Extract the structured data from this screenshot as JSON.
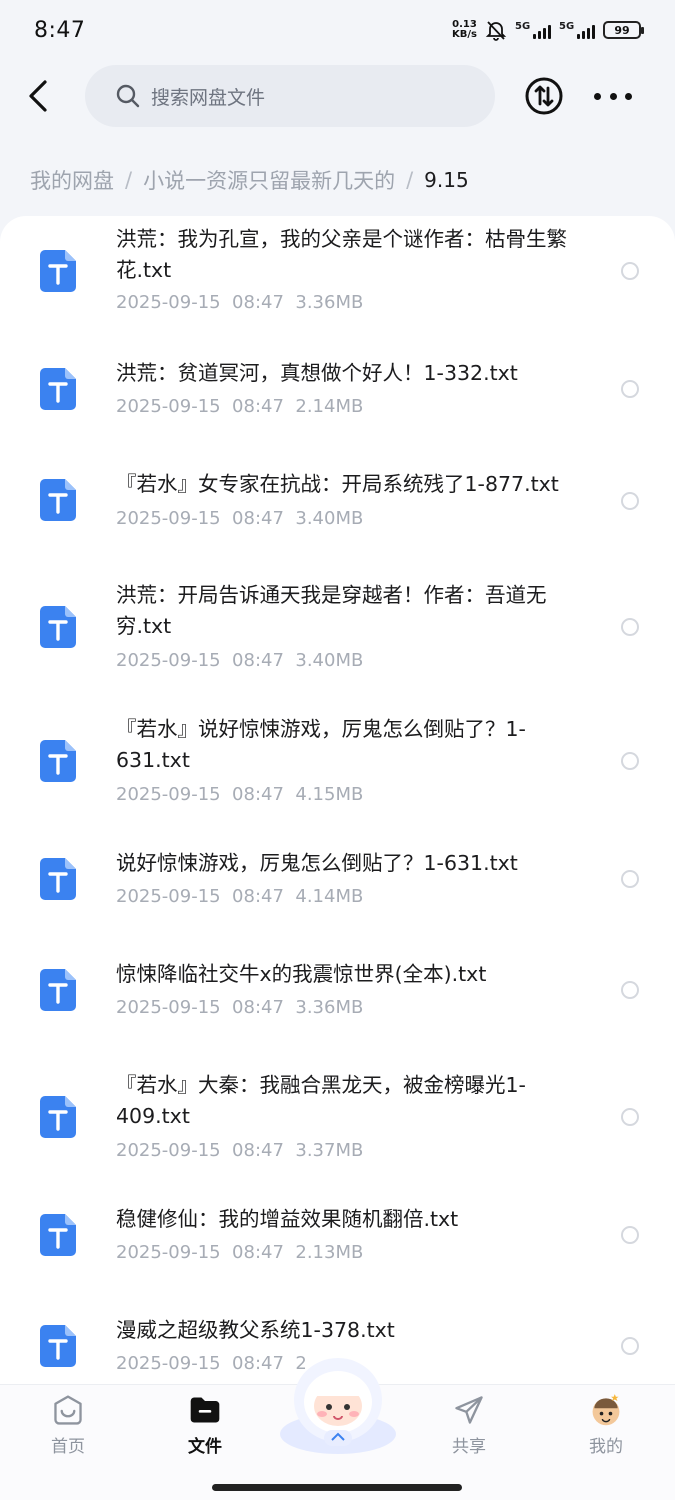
{
  "status_bar": {
    "time": "8:47",
    "net_speed_value": "0.13",
    "net_speed_unit": "KB/s",
    "signal_1": "5G",
    "signal_2": "5G",
    "battery": "99"
  },
  "header": {
    "search_placeholder": "搜索网盘文件"
  },
  "breadcrumb": {
    "items": [
      "我的网盘",
      "小说一资源只留最新几天的"
    ],
    "separator": "/",
    "current": "9.15"
  },
  "files": [
    {
      "name": "洪荒：我为孔宣，我的父亲是个谜作者：枯骨生繁花.txt",
      "meta": "2025-09-15  08:47  3.36MB"
    },
    {
      "name": "洪荒：贫道冥河，真想做个好人！1-332.txt",
      "meta": "2025-09-15  08:47  2.14MB"
    },
    {
      "name": "『若水』女专家在抗战：开局系统残了1-877.txt",
      "meta": "2025-09-15  08:47  3.40MB"
    },
    {
      "name": "洪荒：开局告诉通天我是穿越者！作者：吾道无穷.txt",
      "meta": "2025-09-15  08:47  3.40MB"
    },
    {
      "name": "『若水』说好惊悚游戏，厉鬼怎么倒贴了？1-631.txt",
      "meta": "2025-09-15  08:47  4.15MB"
    },
    {
      "name": "说好惊悚游戏，厉鬼怎么倒贴了？1-631.txt",
      "meta": "2025-09-15  08:47  4.14MB"
    },
    {
      "name": "惊悚降临社交牛x的我震惊世界(全本).txt",
      "meta": "2025-09-15  08:47  3.36MB"
    },
    {
      "name": "『若水』大秦：我融合黑龙天，被金榜曝光1-409.txt",
      "meta": "2025-09-15  08:47  3.37MB"
    },
    {
      "name": "稳健修仙：我的增益效果随机翻倍.txt",
      "meta": "2025-09-15  08:47  2.13MB"
    },
    {
      "name": "漫威之超级教父系统1-378.txt",
      "meta": "2025-09-15  08:47  2"
    }
  ],
  "bottom_nav": {
    "home": "首页",
    "files": "文件",
    "share": "共享",
    "mine": "我的"
  },
  "colors": {
    "file_icon": "#3b82f0",
    "background": "#f3f5f9"
  }
}
